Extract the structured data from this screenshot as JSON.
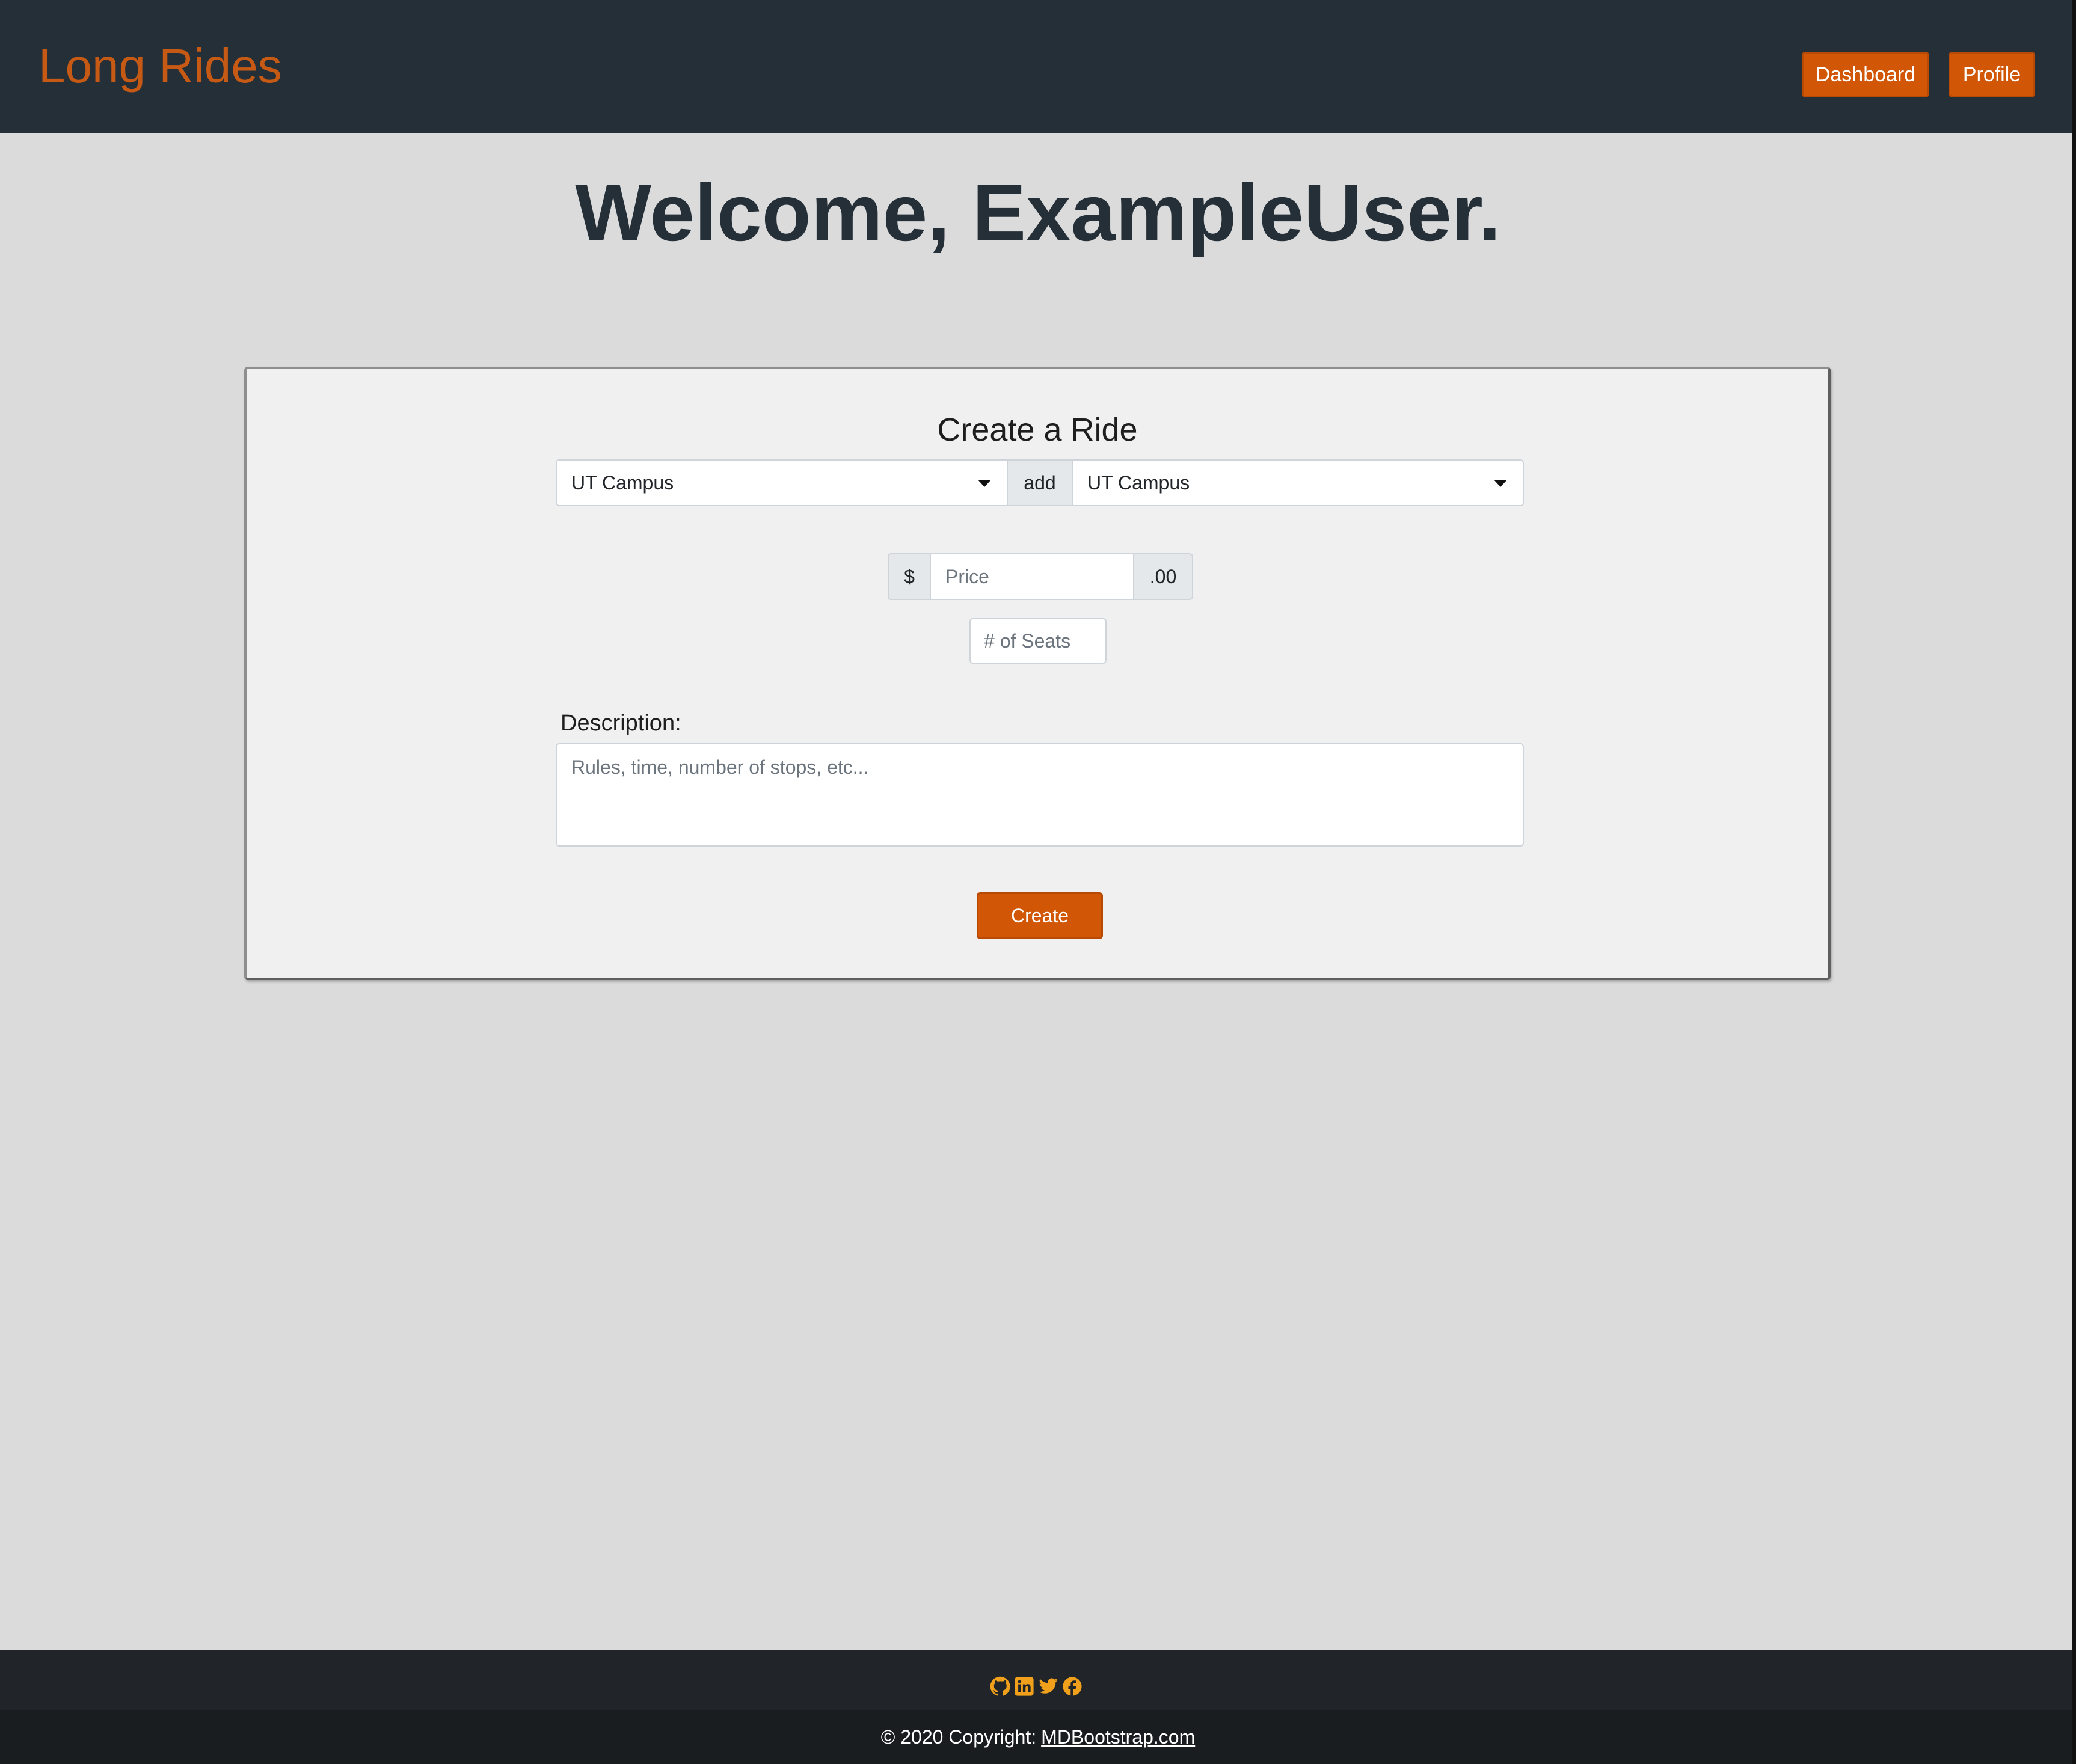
{
  "navbar": {
    "brand": "Long Rides",
    "dashboard_label": "Dashboard",
    "profile_label": "Profile"
  },
  "welcome": {
    "heading": "Welcome, ExampleUser."
  },
  "form": {
    "title": "Create a Ride",
    "from_value": "UT Campus",
    "connector": "add",
    "to_value": "UT Campus",
    "currency_prefix": "$",
    "price_placeholder": "Price",
    "price_suffix": ".00",
    "seats_placeholder": "# of Seats",
    "description_label": "Description:",
    "description_placeholder": "Rules, time, number of stops, etc...",
    "create_label": "Create"
  },
  "footer": {
    "social_icons": [
      "github-icon",
      "linkedin-icon",
      "twitter-icon",
      "facebook-icon"
    ],
    "copyright_text": "© 2020 Copyright:",
    "copyright_link": "MDBootstrap.com"
  },
  "colors": {
    "navbar_bg": "#252f38",
    "accent": "#d15605",
    "brand_text": "#c65a14",
    "page_bg": "#dbdbdb",
    "card_bg": "#f0f0f0",
    "footer_bg": "#212529",
    "social_icon": "#f0a01a"
  }
}
